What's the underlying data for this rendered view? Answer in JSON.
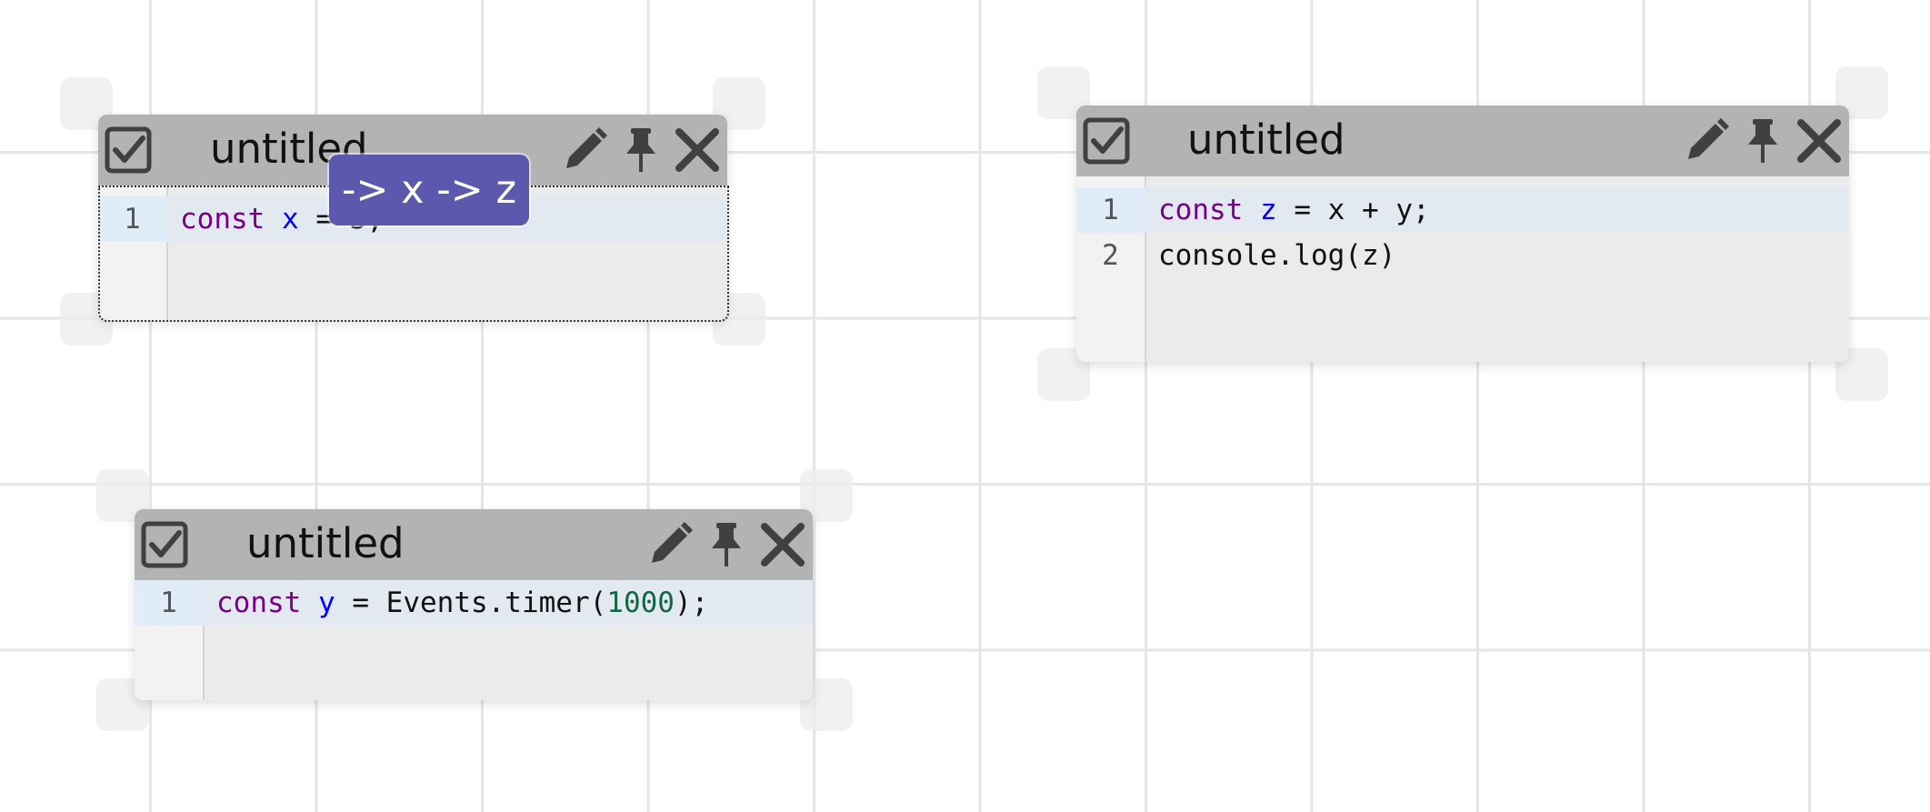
{
  "colors": {
    "header": "#b3b3b3",
    "body": "#ebebeb",
    "keyword": "#770088",
    "variable": "#0000ff",
    "number": "#116644",
    "tooltip_bg": "#5b58ad"
  },
  "icons": {
    "checkbox": "checkbox-checked-icon",
    "edit": "pencil-icon",
    "pin": "pin-icon",
    "close": "close-icon"
  },
  "cells": [
    {
      "title": "untitled",
      "lines": [
        {
          "num": "1",
          "kw": "const",
          "var": "x",
          "rest": " = 3;"
        }
      ]
    },
    {
      "title": "untitled",
      "lines": [
        {
          "num": "1",
          "kw": "const",
          "var": "z",
          "rest": " = x + y;"
        },
        {
          "num": "2",
          "text": "console.log(z)"
        }
      ]
    },
    {
      "title": "untitled",
      "lines": [
        {
          "num": "1",
          "kw": "const",
          "var": "y",
          "rest_a": " = Events.timer(",
          "number": "1000",
          "rest_b": ");"
        }
      ]
    }
  ],
  "tooltip": {
    "text": "-> x -> z"
  }
}
